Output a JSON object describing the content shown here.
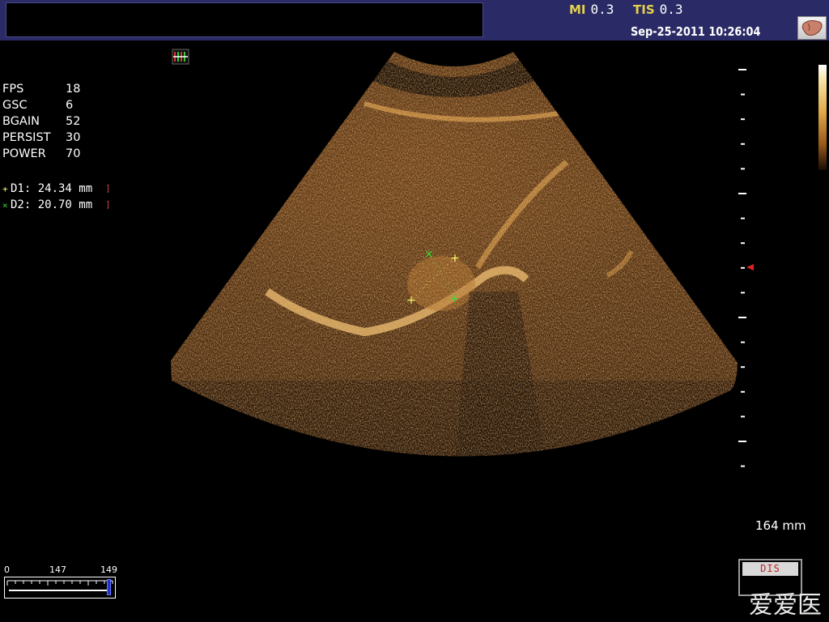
{
  "header": {
    "mi_label": "MI",
    "mi_value": "0.3",
    "tis_label": "TIS",
    "tis_value": "0.3",
    "datetime": "Sep-25-2011 10:26:04"
  },
  "parameters": [
    {
      "label": "FPS",
      "value": "18"
    },
    {
      "label": "GSC",
      "value": "6"
    },
    {
      "label": "BGAIN",
      "value": "52"
    },
    {
      "label": "PERSIST",
      "value": "30"
    },
    {
      "label": "POWER",
      "value": "70"
    }
  ],
  "measurements": [
    {
      "marker": "+",
      "text": "D1: 24.34 mm",
      "color": "#ffff66"
    },
    {
      "marker": "×",
      "text": "D2: 20.70 mm",
      "color": "#33dd33"
    }
  ],
  "depth": "164 mm",
  "cine": {
    "start": "0",
    "current": "147",
    "end": "149",
    "fraction": 0.987
  },
  "dis_button": "DIS",
  "watermark": "爱爱医",
  "colors": {
    "header_bg": "#2a2a66",
    "mi_label": "#e6d24a",
    "tint": "#c8863a",
    "caliper_d1": "#ffff66",
    "caliper_d2": "#33dd33"
  }
}
